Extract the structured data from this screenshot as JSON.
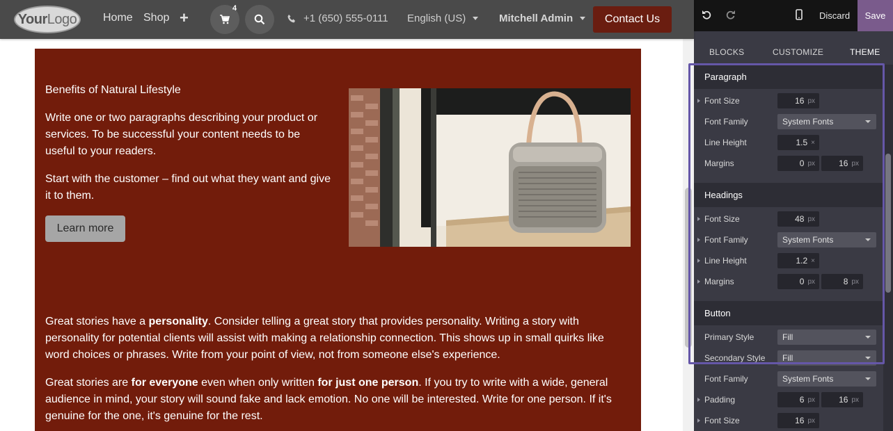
{
  "navbar": {
    "logo_text_bold": "Your",
    "logo_text_light": "Logo",
    "home_label": "Home",
    "shop_label": "Shop",
    "add_symbol": "+",
    "cart_count": "4",
    "phone_number": "+1 (650) 555-0111",
    "language": "English (US)",
    "user_name": "Mitchell Admin",
    "contact_label": "Contact Us"
  },
  "section": {
    "heading": "Benefits of Natural Lifestyle",
    "paragraph1": "Write one or two paragraphs describing your product or services. To be successful your content needs to be useful to your readers.",
    "paragraph2": "Start with the customer – find out what they want and give it to them.",
    "learn_more_label": "Learn more"
  },
  "story": {
    "p1_a": "Great stories have a ",
    "p1_b": "personality",
    "p1_c": ". Consider telling a great story that provides personality. Writing a story with personality for potential clients will assist with making a relationship connection. This shows up in small quirks like word choices or phrases. Write from your point of view, not from someone else's experience.",
    "p2_a": "Great stories are ",
    "p2_b": "for everyone",
    "p2_c": " even when only written ",
    "p2_d": "for just one person",
    "p2_e": ". If you try to write with a wide, general audience in mind, your story will sound fake and lack emotion. No one will be interested. Write for one person. If it's genuine for the one, it's genuine for the rest."
  },
  "editor": {
    "discard_label": "Discard",
    "save_label": "Save",
    "tabs": {
      "blocks": "BLOCKS",
      "customize": "CUSTOMIZE",
      "theme": "THEME"
    },
    "paragraph": {
      "title": "Paragraph",
      "font_size_label": "Font Size",
      "font_size": "16",
      "font_size_unit": "px",
      "font_family_label": "Font Family",
      "font_family": "System Fonts",
      "line_height_label": "Line Height",
      "line_height": "1.5",
      "line_height_unit": "×",
      "margins_label": "Margins",
      "margin_top": "0",
      "margin_bottom": "16",
      "margin_unit": "px"
    },
    "headings": {
      "title": "Headings",
      "font_size_label": "Font Size",
      "font_size": "48",
      "font_size_unit": "px",
      "font_family_label": "Font Family",
      "font_family": "System Fonts",
      "line_height_label": "Line Height",
      "line_height": "1.2",
      "line_height_unit": "×",
      "margins_label": "Margins",
      "margin_top": "0",
      "margin_bottom": "8",
      "margin_unit": "px"
    },
    "button": {
      "title": "Button",
      "primary_style_label": "Primary Style",
      "primary_style": "Fill",
      "secondary_style_label": "Secondary Style",
      "secondary_style": "Fill",
      "font_family_label": "Font Family",
      "font_family": "System Fonts",
      "padding_label": "Padding",
      "padding_y": "6",
      "padding_x": "16",
      "padding_unit": "px",
      "font_size_label": "Font Size",
      "font_size": "16",
      "font_size_unit": "px"
    }
  },
  "colors": {
    "navbar_bg": "#4a4a4a",
    "contact_bg": "#6a1d10",
    "section_bg": "#721c0b",
    "save_bg": "#7a5b8c",
    "panel_bg": "#3a3a44",
    "highlight": "#6557a8"
  }
}
